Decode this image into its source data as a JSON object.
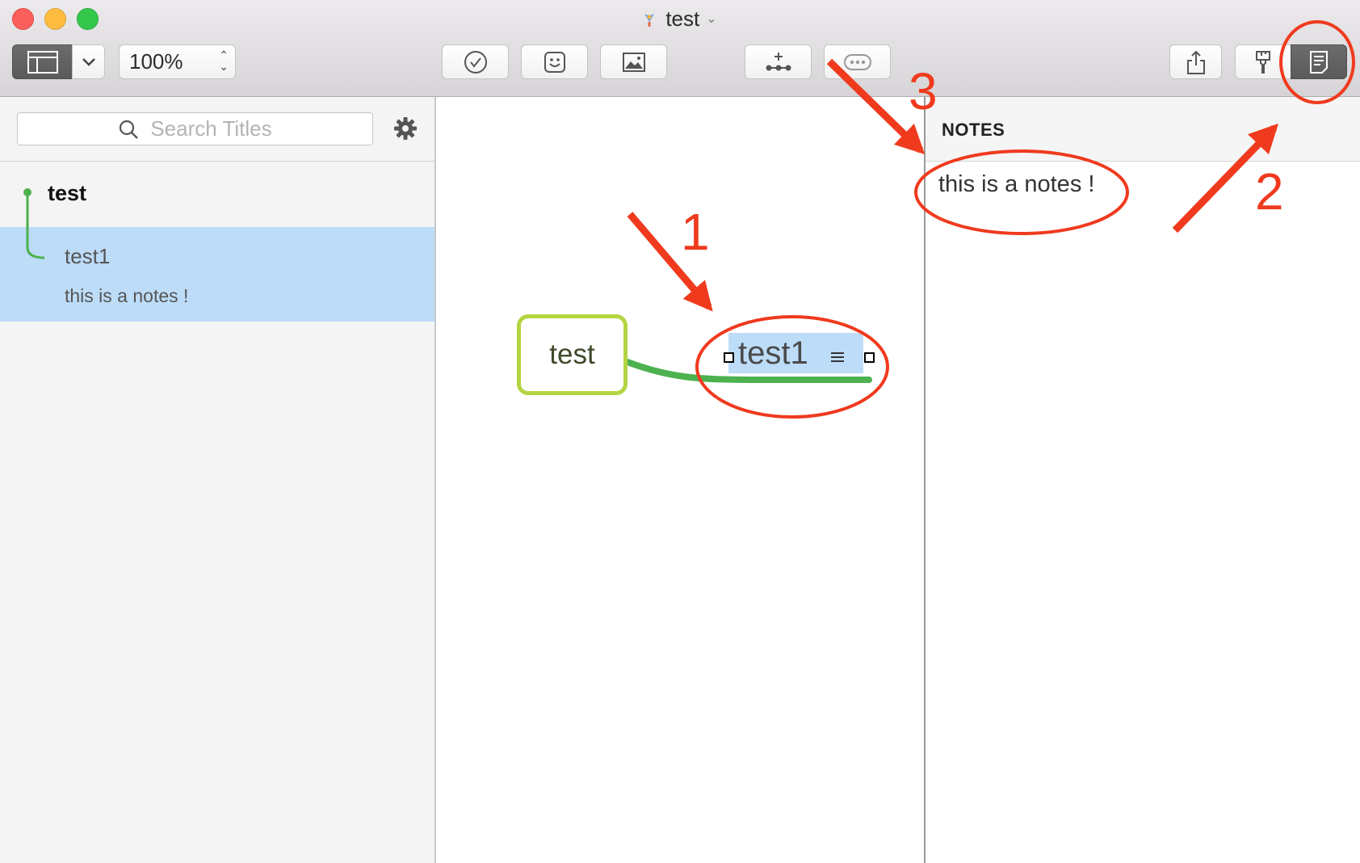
{
  "window": {
    "title": "test"
  },
  "toolbar": {
    "zoom_value": "100%",
    "buttons": [
      {
        "name": "view-mode",
        "icon": "sidebar-layout-icon"
      },
      {
        "name": "view-options",
        "icon": "chevron-down-icon"
      },
      {
        "name": "task",
        "icon": "checkmark-circle-icon"
      },
      {
        "name": "sticker",
        "icon": "sticker-smile-icon"
      },
      {
        "name": "image",
        "icon": "image-icon"
      },
      {
        "name": "add-child",
        "icon": "add-node-icon"
      },
      {
        "name": "add-note",
        "icon": "ellipsis-bubble-icon"
      },
      {
        "name": "share",
        "icon": "share-icon"
      },
      {
        "name": "format",
        "icon": "paintbrush-icon"
      },
      {
        "name": "notes-inspector",
        "icon": "notes-icon"
      }
    ]
  },
  "sidebar": {
    "search_placeholder": "Search Titles",
    "outline": [
      {
        "title": "test",
        "level": 0
      },
      {
        "title": "test1",
        "level": 1,
        "note": "this is a notes !",
        "selected": true
      }
    ]
  },
  "canvas": {
    "root_node": "test",
    "child_node": "test1",
    "colors": {
      "root_border": "#b5d442",
      "branch": "#4cb14e",
      "selection": "#bddcf8"
    }
  },
  "inspector": {
    "header": "NOTES",
    "notes_text": "this is a notes !"
  },
  "annotations": {
    "labels": [
      "1",
      "2",
      "3"
    ],
    "color": "#f03a1e"
  }
}
